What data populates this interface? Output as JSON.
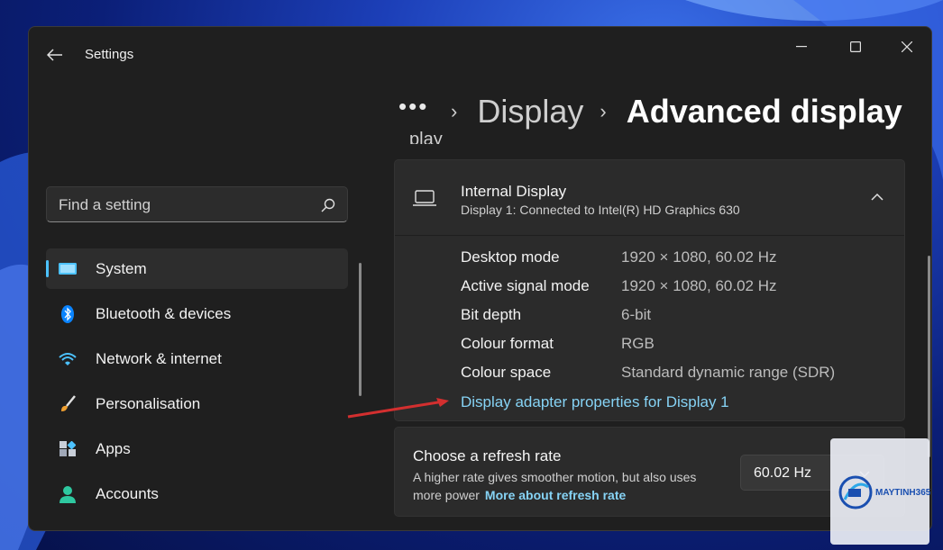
{
  "window": {
    "title": "Settings"
  },
  "breadcrumb": {
    "more": "•••",
    "parent": "Display",
    "current": "Advanced display",
    "partial_heading": "play"
  },
  "search": {
    "placeholder": "Find a setting"
  },
  "sidebar": {
    "items": [
      {
        "label": "System",
        "icon": "system-icon",
        "active": true
      },
      {
        "label": "Bluetooth & devices",
        "icon": "bluetooth-icon"
      },
      {
        "label": "Network & internet",
        "icon": "wifi-icon"
      },
      {
        "label": "Personalisation",
        "icon": "brush-icon"
      },
      {
        "label": "Apps",
        "icon": "apps-icon"
      },
      {
        "label": "Accounts",
        "icon": "account-icon"
      }
    ]
  },
  "display_card": {
    "title": "Internal Display",
    "subtitle": "Display 1: Connected to Intel(R) HD Graphics 630",
    "properties": [
      {
        "label": "Desktop mode",
        "value": "1920 × 1080, 60.02 Hz"
      },
      {
        "label": "Active signal mode",
        "value": "1920 × 1080, 60.02 Hz"
      },
      {
        "label": "Bit depth",
        "value": "6-bit"
      },
      {
        "label": "Colour format",
        "value": "RGB"
      },
      {
        "label": "Colour space",
        "value": "Standard dynamic range (SDR)"
      }
    ],
    "adapter_link": "Display adapter properties for Display 1"
  },
  "refresh_card": {
    "title": "Choose a refresh rate",
    "description": "A higher rate gives smoother motion, but also uses more power",
    "link": "More about refresh rate",
    "selected": "60.02 Hz"
  },
  "watermark": {
    "brand": "MAYTINH365"
  },
  "colors": {
    "accent": "#4cc2ff",
    "link": "#86d3f5",
    "arrow": "#d32f2f"
  }
}
